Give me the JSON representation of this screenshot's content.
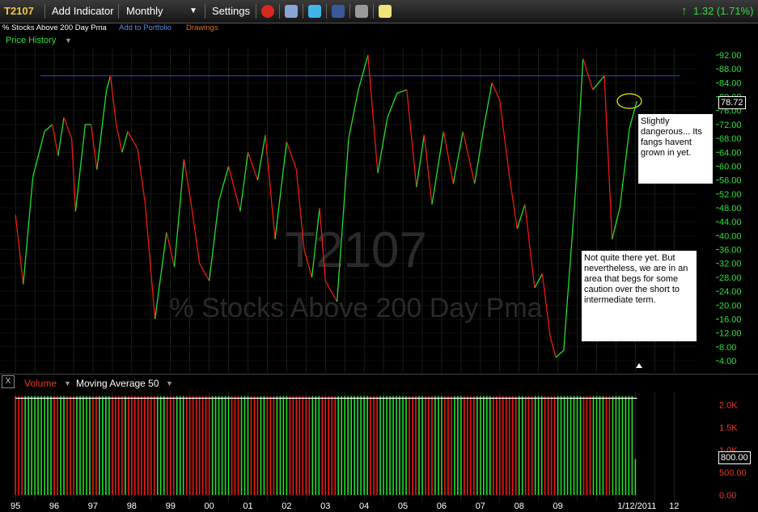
{
  "toolbar": {
    "symbol": "T2107",
    "add_indicator": "Add Indicator",
    "period": "Monthly",
    "settings": "Settings",
    "change": "1.32 (1.71%)",
    "change_color": "#2de03c"
  },
  "subheader": {
    "name": "% Stocks Above 200 Day Pma",
    "add_to_portfolio": "Add to Portfolio",
    "drawings": "Drawings"
  },
  "price_panel": {
    "label": "Price History",
    "current_value": "78.72"
  },
  "watermark": {
    "symbol": "T2107",
    "name": "% Stocks Above 200 Day Pma"
  },
  "volume_panel": {
    "close_label": "X",
    "volume_label": "Volume",
    "ma_label": "Moving Average 50",
    "current_value": "800.00"
  },
  "annotations": {
    "note1": "Slightly dangerous... Its fangs havent grown in yet.",
    "note2": "Not quite there yet. But nevertheless, we are in an area that begs for some caution over the short to intermediate term."
  },
  "chart_data": {
    "type": "line",
    "title": "% Stocks Above 200 Day Pma",
    "ylim": [
      4,
      92
    ],
    "y_ticks": [
      "92.00",
      "88.00",
      "84.00",
      "80.00",
      "76.00",
      "72.00",
      "68.00",
      "64.00",
      "60.00",
      "56.00",
      "52.00",
      "48.00",
      "44.00",
      "40.00",
      "36.00",
      "32.00",
      "28.00",
      "24.00",
      "20.00",
      "16.00",
      "12.00",
      "8.00",
      "4.00"
    ],
    "x_ticks": [
      "95",
      "96",
      "97",
      "98",
      "99",
      "00",
      "01",
      "02",
      "03",
      "04",
      "05",
      "06",
      "07",
      "08",
      "09",
      "1/12/2011",
      "12"
    ],
    "series": [
      {
        "values": [
          {
            "x": 1995.0,
            "y": 46
          },
          {
            "x": 1995.2,
            "y": 26
          },
          {
            "x": 1995.45,
            "y": 57
          },
          {
            "x": 1995.75,
            "y": 70
          },
          {
            "x": 1995.95,
            "y": 72
          },
          {
            "x": 1996.1,
            "y": 63
          },
          {
            "x": 1996.25,
            "y": 74
          },
          {
            "x": 1996.45,
            "y": 68
          },
          {
            "x": 1996.55,
            "y": 47
          },
          {
            "x": 1996.8,
            "y": 72
          },
          {
            "x": 1996.95,
            "y": 72
          },
          {
            "x": 1997.1,
            "y": 59
          },
          {
            "x": 1997.35,
            "y": 82
          },
          {
            "x": 1997.45,
            "y": 86
          },
          {
            "x": 1997.6,
            "y": 72
          },
          {
            "x": 1997.75,
            "y": 64
          },
          {
            "x": 1997.9,
            "y": 70
          },
          {
            "x": 1998.15,
            "y": 65
          },
          {
            "x": 1998.35,
            "y": 49
          },
          {
            "x": 1998.6,
            "y": 16
          },
          {
            "x": 1998.9,
            "y": 41
          },
          {
            "x": 1999.1,
            "y": 31
          },
          {
            "x": 1999.35,
            "y": 62
          },
          {
            "x": 1999.55,
            "y": 48
          },
          {
            "x": 1999.75,
            "y": 32
          },
          {
            "x": 2000.0,
            "y": 27
          },
          {
            "x": 2000.25,
            "y": 50
          },
          {
            "x": 2000.5,
            "y": 60
          },
          {
            "x": 2000.8,
            "y": 47
          },
          {
            "x": 2001.0,
            "y": 64
          },
          {
            "x": 2001.25,
            "y": 56
          },
          {
            "x": 2001.45,
            "y": 69
          },
          {
            "x": 2001.7,
            "y": 39
          },
          {
            "x": 2002.0,
            "y": 67
          },
          {
            "x": 2002.25,
            "y": 59
          },
          {
            "x": 2002.45,
            "y": 36
          },
          {
            "x": 2002.65,
            "y": 28
          },
          {
            "x": 2002.85,
            "y": 48
          },
          {
            "x": 2003.0,
            "y": 27
          },
          {
            "x": 2003.3,
            "y": 21
          },
          {
            "x": 2003.6,
            "y": 68
          },
          {
            "x": 2003.85,
            "y": 82
          },
          {
            "x": 2004.1,
            "y": 92
          },
          {
            "x": 2004.35,
            "y": 58
          },
          {
            "x": 2004.6,
            "y": 74
          },
          {
            "x": 2004.85,
            "y": 81
          },
          {
            "x": 2005.1,
            "y": 82
          },
          {
            "x": 2005.35,
            "y": 54
          },
          {
            "x": 2005.55,
            "y": 69
          },
          {
            "x": 2005.75,
            "y": 49
          },
          {
            "x": 2006.05,
            "y": 70
          },
          {
            "x": 2006.3,
            "y": 55
          },
          {
            "x": 2006.55,
            "y": 70
          },
          {
            "x": 2006.85,
            "y": 55
          },
          {
            "x": 2007.1,
            "y": 72
          },
          {
            "x": 2007.3,
            "y": 84
          },
          {
            "x": 2007.5,
            "y": 79
          },
          {
            "x": 2007.75,
            "y": 57
          },
          {
            "x": 2007.95,
            "y": 42
          },
          {
            "x": 2008.15,
            "y": 49
          },
          {
            "x": 2008.4,
            "y": 25
          },
          {
            "x": 2008.6,
            "y": 29
          },
          {
            "x": 2008.8,
            "y": 11
          },
          {
            "x": 2008.95,
            "y": 5
          },
          {
            "x": 2009.15,
            "y": 7
          },
          {
            "x": 2009.45,
            "y": 52
          },
          {
            "x": 2009.65,
            "y": 91
          },
          {
            "x": 2009.9,
            "y": 82
          },
          {
            "x": 2010.2,
            "y": 86
          },
          {
            "x": 2010.4,
            "y": 39
          },
          {
            "x": 2010.6,
            "y": 48
          },
          {
            "x": 2010.85,
            "y": 71
          },
          {
            "x": 2011.04,
            "y": 78.72
          }
        ]
      }
    ],
    "horizontal_line": {
      "y": 86
    },
    "volume": {
      "ylim": [
        0,
        2300
      ],
      "y_ticks": [
        "2.0K",
        "1.5K",
        "1.0K",
        "500.00",
        "0.00"
      ],
      "level": 2200,
      "ma_level": 2150,
      "last_value": 800
    }
  }
}
